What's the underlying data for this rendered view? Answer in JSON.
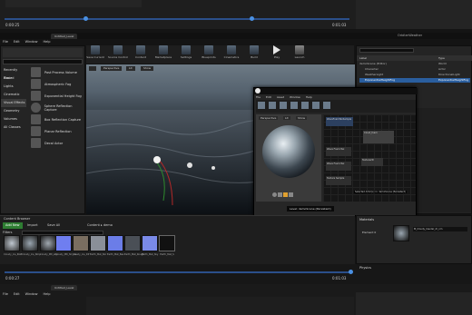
{
  "top_timeline": {
    "time_left": "0:00:25",
    "time_right": "0:01:03"
  },
  "bottom_timeline": {
    "time_left": "0:00:27",
    "time_right": "0:01:03"
  },
  "menus": {
    "main": [
      "File",
      "Edit",
      "Window",
      "Help"
    ],
    "material": [
      "File",
      "Edit",
      "Asset",
      "Window",
      "Help"
    ]
  },
  "tabs": {
    "editor": "Untitled_Level",
    "project_title": "OrbiterWeather"
  },
  "modes": {
    "search_placeholder": "Search Classes",
    "categories": [
      "Recently Placed",
      "Basic",
      "Lights",
      "Cinematic",
      "Visual Effects",
      "Geometry",
      "Volumes",
      "All Classes"
    ],
    "selected_category": "Visual Effects",
    "items": [
      "Post Process Volume",
      "Atmospheric Fog",
      "Exponential Height Fog",
      "Sphere Reflection Capture",
      "Box Reflection Capture",
      "Planar Reflection",
      "Decal Actor"
    ]
  },
  "toolbar": {
    "buttons": [
      "Save Current",
      "Source Control",
      "Content",
      "Marketplace",
      "Settings",
      "Blueprints",
      "Cinematics",
      "Build",
      "Play",
      "Launch"
    ]
  },
  "viewport": {
    "perspective": "Perspective",
    "lit": "Lit",
    "show": "Show"
  },
  "material_editor": {
    "toolbar": [
      "Save",
      "Find in CB",
      "Apply",
      "Search",
      "Home",
      "Clean Up",
      "Connectors",
      "Live Preview",
      "Live Nodes",
      "Live Update",
      "Hide Unrelated"
    ],
    "viewport_tabs": [
      "Perspective",
      "Lit",
      "Show"
    ],
    "nodes": [
      "WaveFoamTexSample",
      "Cloud_foam",
      "Wave Foam.Tex",
      "Wave Foam.Tex",
      "Texture2D",
      "Texture Sample"
    ],
    "tooltip": "Selected Actor(s) in: demoScene (Persistent)",
    "status": "Level: demoScene (Persistent)"
  },
  "world_outliner": {
    "search_placeholder": "Search...",
    "columns": [
      "Label",
      "Type"
    ],
    "rows": [
      {
        "label": "demoScene (Editor)",
        "type": "World"
      },
      {
        "label": "Character",
        "type": "Actor"
      },
      {
        "label": "WeatherLight",
        "type": "DirectionalLight"
      },
      {
        "label": "ExponentialHeightFog",
        "type": "ExponentialHeightFog"
      }
    ]
  },
  "details": {
    "title": "Details",
    "section_material": "Materials",
    "element": "Element 0",
    "material_name": "M_Cloudy_Cauder_dr_nm",
    "physics": "Physics",
    "static_mesh": "Static Mesh",
    "mobility": "Mobility"
  },
  "content_browser": {
    "title": "Content Browser",
    "add_new": "Add New",
    "import": "Import",
    "save_all": "Save All",
    "path": [
      "Content",
      "demo"
    ],
    "filters": "Filters",
    "search_placeholder": "Search demo",
    "assets": [
      {
        "name": "Cloudy_Ice_RGB",
        "color": "#9aa6b0"
      },
      {
        "name": "Cloudy_Ice_Nmp",
        "color": "#6f7ef0"
      },
      {
        "name": "Cloudy_Mtl_sky",
        "color": "#7a6e60"
      },
      {
        "name": "Cloudy_Mtl_SO_ice",
        "color": "#8a8f98"
      },
      {
        "name": "Cloudy_Ice_Dif",
        "color": "#6b7de8"
      },
      {
        "name": "Earth_Mat_Nor",
        "color": "#4a4f56"
      },
      {
        "name": "Earth_Mat_Bas",
        "color": "#5d6066"
      },
      {
        "name": "Earth_Mat_Rough",
        "color": "#7a8ae8"
      },
      {
        "name": "Earth_Mat_Sky",
        "color": "#cfcfcf"
      },
      {
        "name": "Earth_Mat_S",
        "color": "#111111"
      },
      {
        "name": "Foam_Tex",
        "color": "#2b2b2b"
      }
    ]
  }
}
